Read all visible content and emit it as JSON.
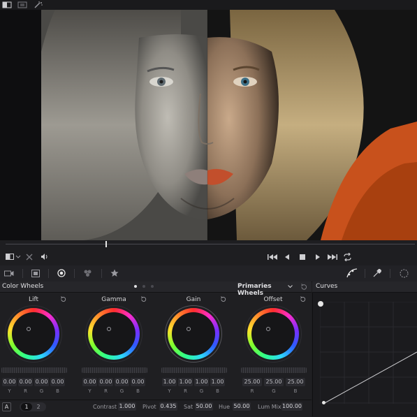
{
  "viewer": {
    "scrub_position": 0.26
  },
  "color_wheels": {
    "title": "Color Wheels",
    "mode_label": "Primaries Wheels",
    "pages": 3,
    "active_page": 1,
    "wheels": [
      {
        "name": "Lift",
        "values": [
          "0.00",
          "0.00",
          "0.00",
          "0.00"
        ],
        "channels": [
          "Y",
          "R",
          "G",
          "B"
        ]
      },
      {
        "name": "Gamma",
        "values": [
          "0.00",
          "0.00",
          "0.00",
          "0.00"
        ],
        "channels": [
          "Y",
          "R",
          "G",
          "B"
        ]
      },
      {
        "name": "Gain",
        "values": [
          "1.00",
          "1.00",
          "1.00",
          "1.00"
        ],
        "channels": [
          "Y",
          "R",
          "G",
          "B"
        ]
      },
      {
        "name": "Offset",
        "values": [
          "25.00",
          "25.00",
          "25.00"
        ],
        "channels": [
          "R",
          "G",
          "B"
        ]
      }
    ]
  },
  "bottom": {
    "auto_label": "A",
    "page_1": "1",
    "page_2": "2",
    "contrast_label": "Contrast",
    "contrast_value": "1.000",
    "pivot_label": "Pivot",
    "pivot_value": "0.435",
    "sat_label": "Sat",
    "sat_value": "50.00",
    "hue_label": "Hue",
    "hue_value": "50.00",
    "lum_mix_label": "Lum Mix",
    "lum_mix_value": "100.00"
  },
  "curves": {
    "title": "Curves"
  },
  "colors": {
    "accent": "#e8e8e8",
    "panel": "#1f1f22",
    "header": "#26262a"
  }
}
